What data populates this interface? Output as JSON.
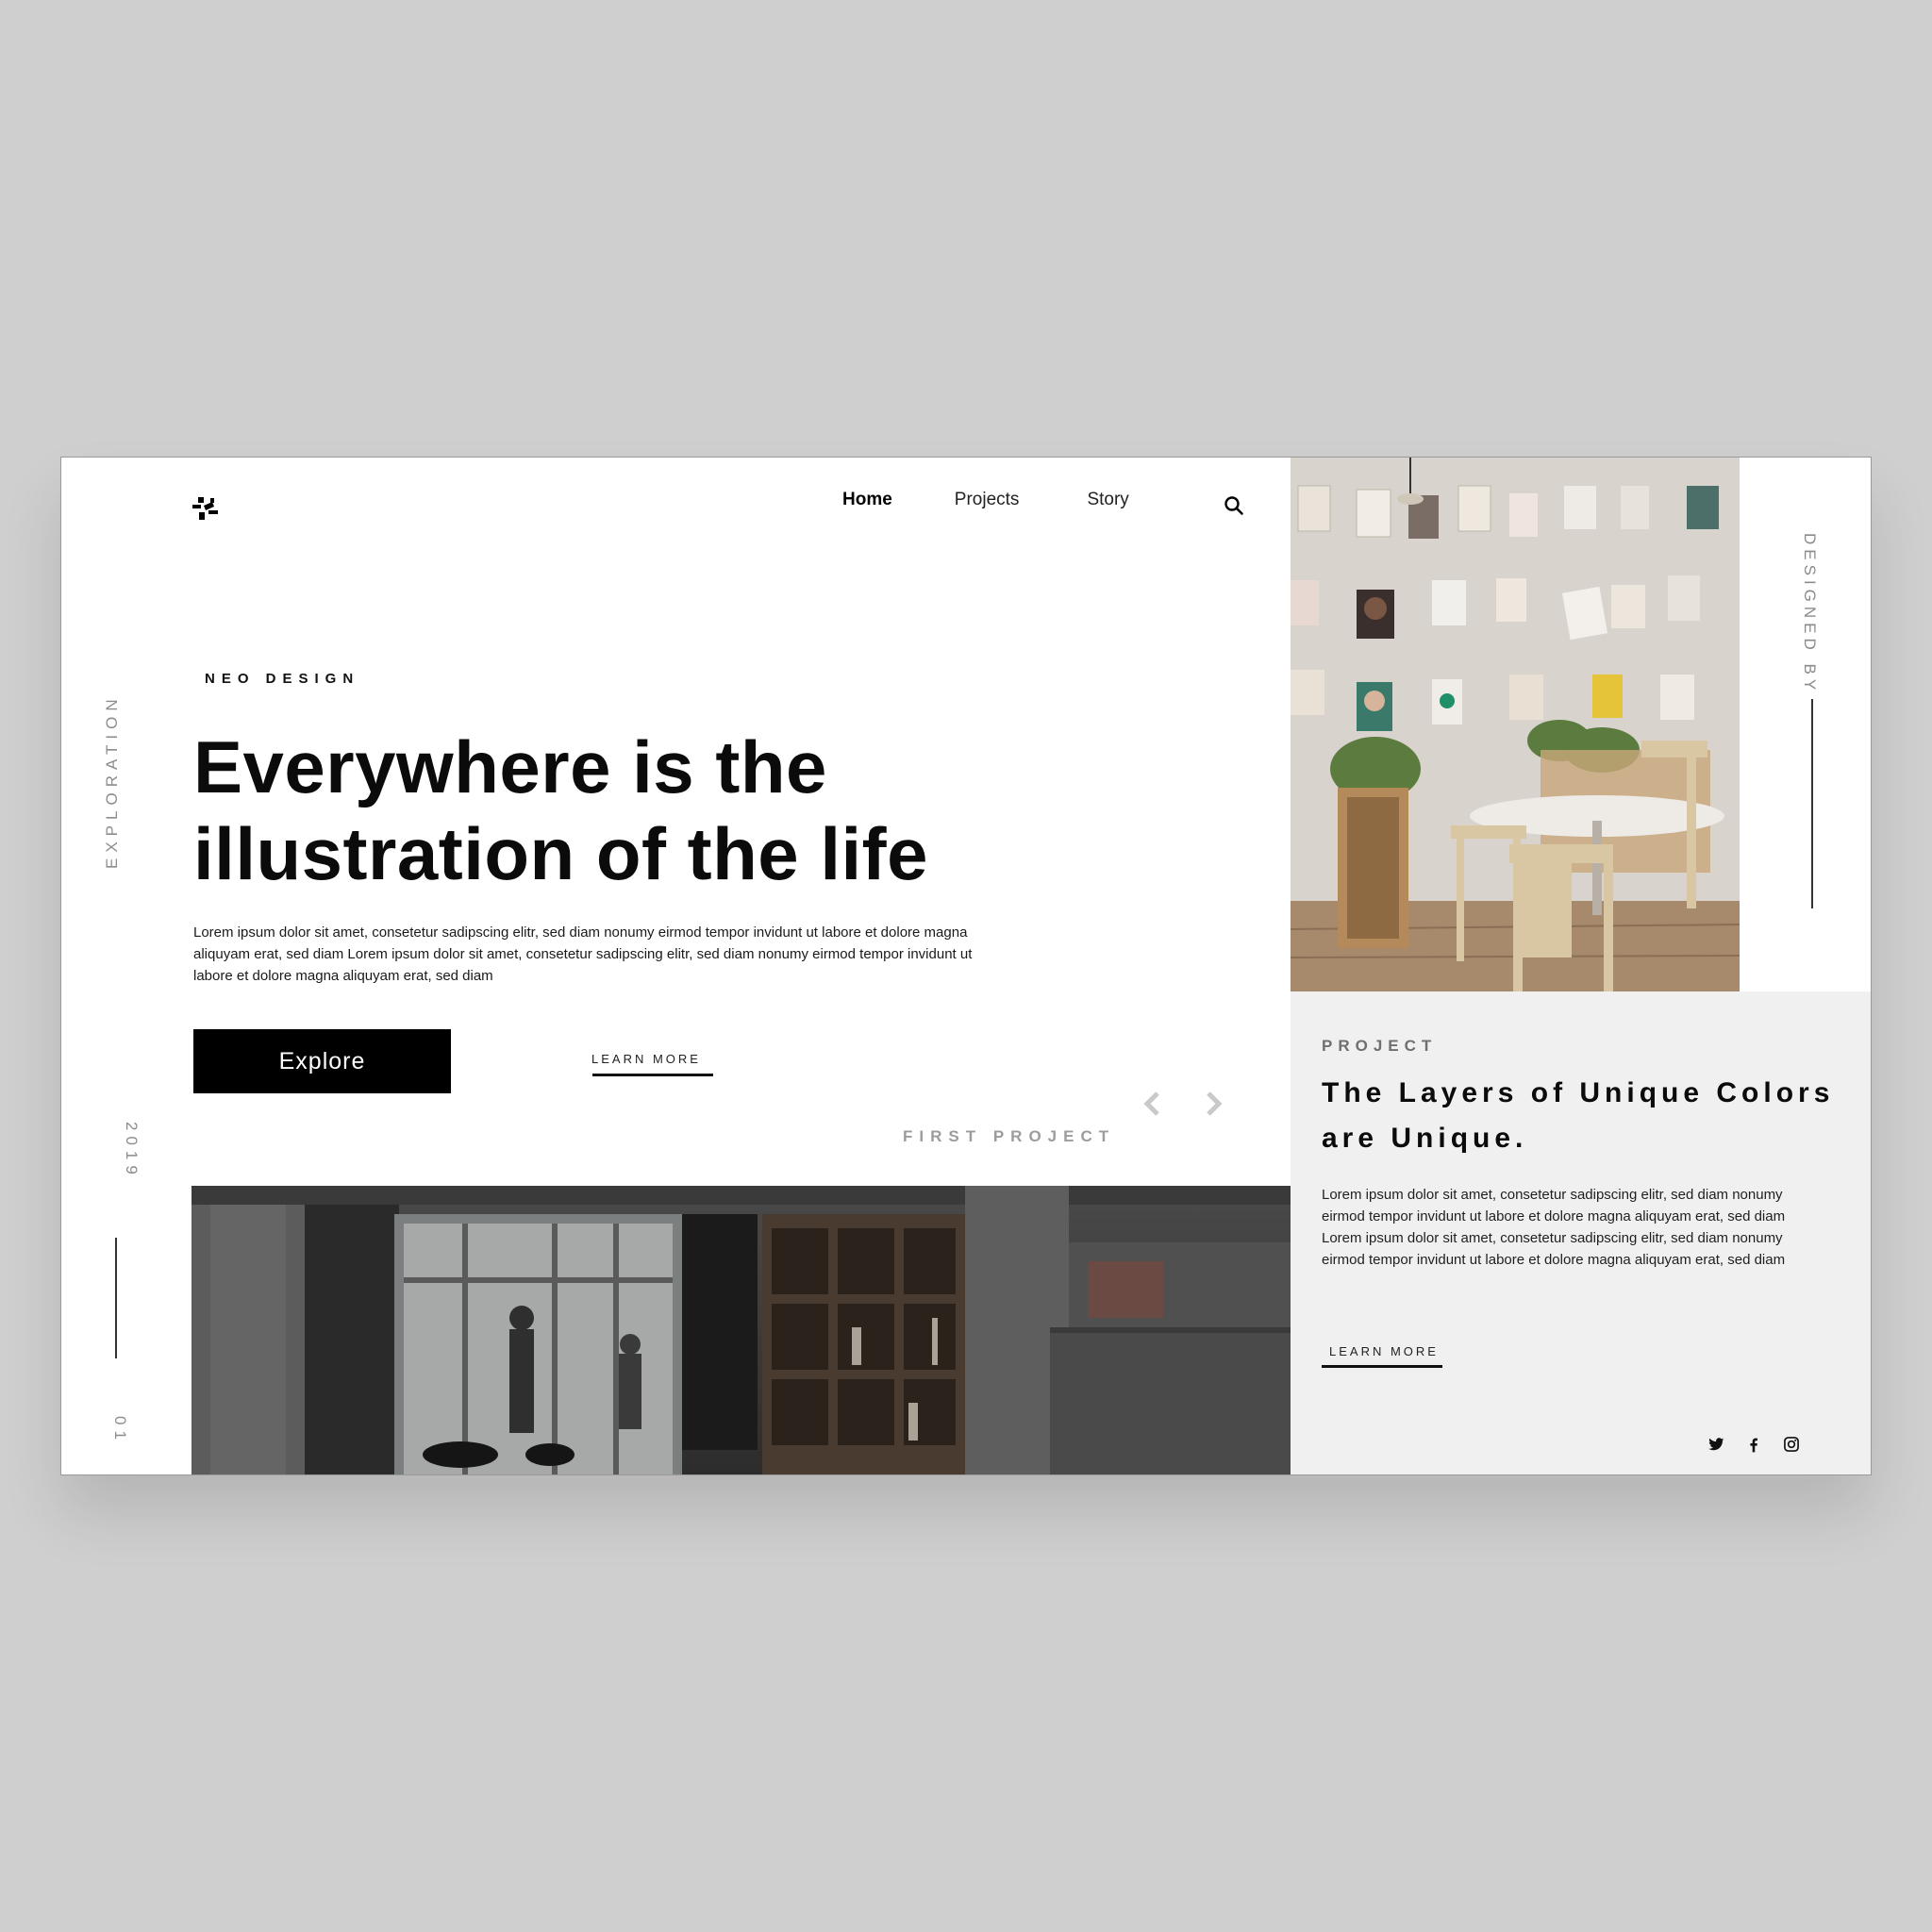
{
  "nav": {
    "home": "Home",
    "projects": "Projects",
    "story": "Story"
  },
  "rail": {
    "exploration": "EXPLORATION",
    "year": "2019",
    "index": "01"
  },
  "right_rail": {
    "designed_by": "DESIGNED BY"
  },
  "hero": {
    "eyebrow": "NEO DESIGN",
    "title_line1": "Everywhere is the",
    "title_line2": "illustration of the life",
    "body": "Lorem ipsum dolor sit amet, consetetur sadipscing elitr, sed diam nonumy eirmod tempor invidunt ut labore et dolore magna aliquyam erat, sed diam Lorem ipsum dolor sit amet, consetetur sadipscing elitr, sed diam nonumy eirmod tempor invidunt ut labore et dolore magna aliquyam erat, sed diam",
    "explore_label": "Explore",
    "learn_more": "LEARN MORE",
    "first_project": "FIRST PROJECT"
  },
  "project": {
    "label": "PROJECT",
    "title": "The Layers of Unique Colors are Unique.",
    "body": "Lorem ipsum dolor sit amet, consetetur sadipscing elitr, sed diam nonumy eirmod tempor invidunt ut labore et dolore magna aliquyam erat, sed diam Lorem ipsum dolor sit amet, consetetur sadipscing elitr, sed diam nonumy eirmod tempor invidunt ut labore et dolore magna aliquyam erat, sed diam",
    "learn_more": "LEARN MORE"
  },
  "icons": [
    "logo-icon",
    "search-icon",
    "prev-arrow-icon",
    "next-arrow-icon",
    "twitter-icon",
    "facebook-icon",
    "instagram-icon"
  ],
  "colors": {
    "accent": "#000000",
    "panel_bg": "#f0f0f0",
    "muted": "#9c9c9c"
  }
}
